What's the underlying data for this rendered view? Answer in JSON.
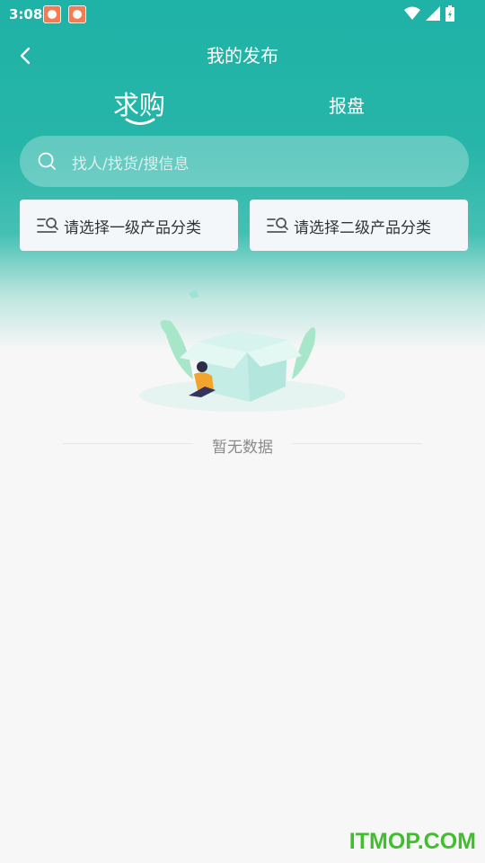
{
  "status_bar": {
    "time": "3:08"
  },
  "nav": {
    "title": "我的发布"
  },
  "tabs": [
    {
      "label": "求购",
      "active": true
    },
    {
      "label": "报盘",
      "active": false
    }
  ],
  "search": {
    "placeholder": "找人/找货/搜信息"
  },
  "filters": [
    {
      "label": "请选择一级产品分类"
    },
    {
      "label": "请选择二级产品分类"
    }
  ],
  "empty": {
    "text": "暂无数据"
  },
  "watermark": "ITMOP.COM",
  "colors": {
    "primary": "#1fb2a6",
    "background": "#f7f7f7"
  }
}
